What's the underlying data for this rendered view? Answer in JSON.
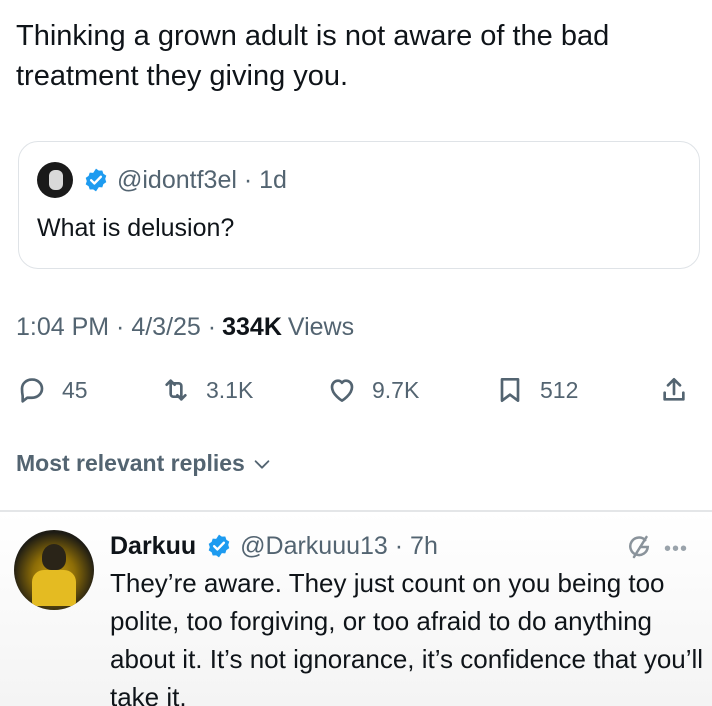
{
  "tweet": {
    "text": "Thinking a grown adult is not aware of the bad treatment they giving you."
  },
  "quote": {
    "handle_time": "@idontf3el · 1d",
    "text": "What is delusion?"
  },
  "meta": {
    "timestamp": "1:04 PM · 4/3/25 ·",
    "views_count": "334K",
    "views_label": "Views"
  },
  "actions": {
    "replies": "45",
    "reposts": "3.1K",
    "likes": "9.7K",
    "bookmarks": "512"
  },
  "replies_section": {
    "label": "Most relevant replies"
  },
  "reply": {
    "name": "Darkuu",
    "handle_time": "@Darkuuu13 · 7h",
    "text": "They’re aware. They just count on you being too polite, too forgiving, or too afraid to do anything about it. It’s not ignorance, it’s confidence that you’ll take it."
  },
  "colors": {
    "verified": "#1d9bf0",
    "text_primary": "#0f1419",
    "text_secondary": "#536471"
  },
  "icons": [
    "reply-icon",
    "repost-icon",
    "like-icon",
    "bookmark-icon",
    "share-icon",
    "verified-icon",
    "chevron-down-icon",
    "grok-icon",
    "more-icon"
  ]
}
